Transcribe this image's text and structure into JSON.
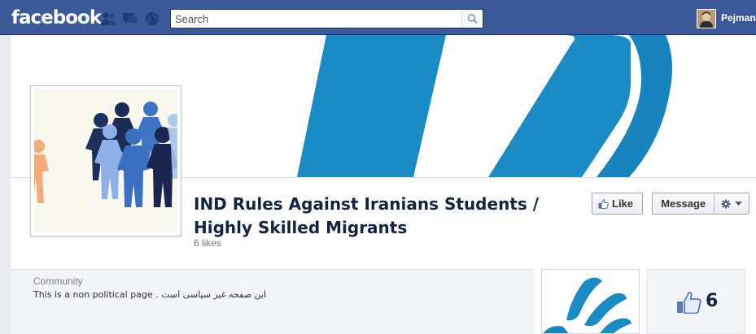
{
  "header": {
    "logo_text": "facebook",
    "search_placeholder": "Search",
    "username": "Pejman",
    "icons": [
      "friends-icon",
      "messages-icon",
      "notifications-icon",
      "search-icon"
    ]
  },
  "page": {
    "title": "IND Rules Against Iranians Students / Highly Skilled Migrants",
    "likes_label": "6 likes",
    "like_button": "Like",
    "message_button": "Message"
  },
  "about": {
    "category": "Community",
    "description": "This is a non political page . این صفحه غیر سیاسی است"
  },
  "likes_box": {
    "count": "6"
  },
  "colors": {
    "brand": "#3b5998",
    "cover_blue": "#1a8bc4",
    "title": "#14243f"
  }
}
